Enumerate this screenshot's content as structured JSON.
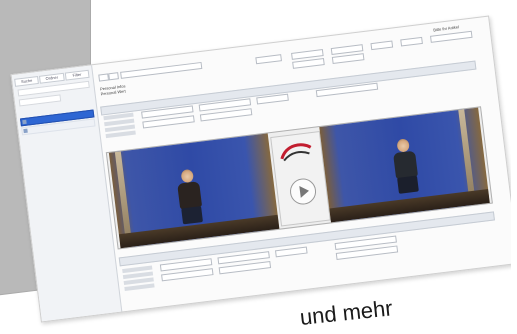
{
  "sidebar": {
    "tabs": [
      "Suche",
      "Ordner",
      "Filter"
    ],
    "items": [
      "",
      "",
      ""
    ]
  },
  "toolbar": {
    "labels": [
      "Personal Infos",
      "Personal Wert",
      "Personal Einheiten"
    ],
    "right_label": "Bitte Ihr Artikel"
  },
  "video": {
    "logo_colors": [
      "#c21d2f",
      "#333333"
    ]
  },
  "caption": "und mehr",
  "colors": {
    "selection": "#2e66d3",
    "backdrop": "#2f4aa6",
    "accent_red": "#c23"
  }
}
